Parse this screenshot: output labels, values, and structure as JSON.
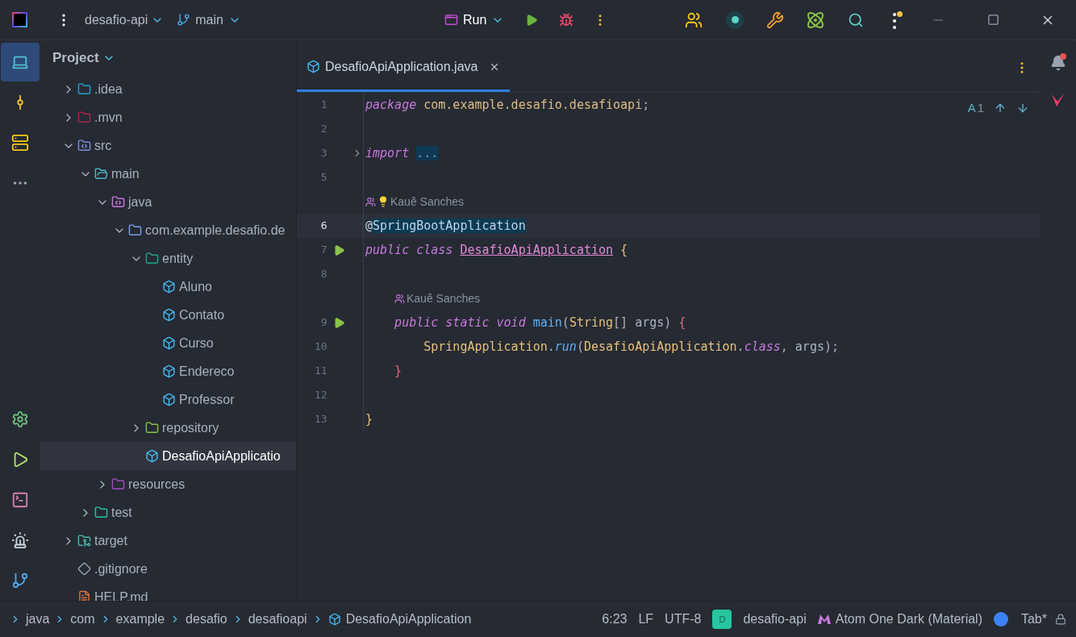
{
  "title_bar": {
    "project": "desafio-api",
    "branch": "main",
    "run_config": "Run"
  },
  "tool_strip": {
    "top": [
      {
        "kind": "project",
        "selected": true
      },
      {
        "kind": "commit",
        "selected": false
      },
      {
        "kind": "structure",
        "selected": false
      },
      {
        "kind": "more",
        "selected": false
      }
    ],
    "bottom": [
      {
        "kind": "settings"
      },
      {
        "kind": "run"
      },
      {
        "kind": "terminal"
      },
      {
        "kind": "problems"
      },
      {
        "kind": "git"
      }
    ]
  },
  "project_panel": {
    "title": "Project",
    "tree": [
      {
        "label": ".idea",
        "kind": "idea",
        "expanded": false,
        "selected": false
      },
      {
        "label": ".mvn",
        "kind": "mvn",
        "expanded": false,
        "selected": false
      },
      {
        "label": "src",
        "kind": "source",
        "expanded": true,
        "selected": false,
        "children": [
          {
            "label": "main",
            "kind": "main",
            "expanded": true,
            "selected": false,
            "children": [
              {
                "label": "java",
                "kind": "java",
                "expanded": true,
                "selected": false,
                "children": [
                  {
                    "label": "com.example.desafio.de",
                    "kind": "package",
                    "expanded": true,
                    "selected": false,
                    "children": [
                      {
                        "label": "entity",
                        "kind": "entity",
                        "expanded": true,
                        "selected": false,
                        "children": [
                          {
                            "label": "Aluno",
                            "kind": "class",
                            "selected": false
                          },
                          {
                            "label": "Contato",
                            "kind": "class",
                            "selected": false
                          },
                          {
                            "label": "Curso",
                            "kind": "class",
                            "selected": false
                          },
                          {
                            "label": "Endereco",
                            "kind": "class",
                            "selected": false
                          },
                          {
                            "label": "Professor",
                            "kind": "class",
                            "selected": false
                          }
                        ]
                      },
                      {
                        "label": "repository",
                        "kind": "repository",
                        "expanded": false,
                        "selected": false
                      },
                      {
                        "label": "DesafioApiApplicatio",
                        "kind": "app",
                        "selected": true
                      }
                    ]
                  }
                ]
              },
              {
                "label": "resources",
                "kind": "resources",
                "expanded": false,
                "selected": false
              }
            ]
          },
          {
            "label": "test",
            "kind": "test",
            "expanded": false,
            "selected": false
          }
        ]
      },
      {
        "label": "target",
        "kind": "target",
        "expanded": false,
        "selected": false
      },
      {
        "label": ".gitignore",
        "kind": "gitignore",
        "selected": false
      },
      {
        "label": "HELP.md",
        "kind": "markdown",
        "selected": false
      }
    ]
  },
  "editor": {
    "tabs": [
      {
        "label": "DesafioApiApplication.java",
        "selected": true
      }
    ],
    "inspection": {
      "label": "A",
      "count": "1"
    },
    "lines": [
      {
        "kind": "code",
        "number": "1",
        "current": false,
        "run": false,
        "fold": false,
        "tokens": [
          {
            "text": "package",
            "kind": "keyword"
          },
          {
            "text": " com.example.desafio.desafioapi",
            "kind": "path"
          },
          {
            "text": ";",
            "kind": "punct"
          }
        ]
      },
      {
        "kind": "code",
        "number": "2",
        "current": false,
        "run": false,
        "fold": false
      },
      {
        "kind": "code",
        "number": "3",
        "current": false,
        "run": false,
        "fold": true,
        "tokens": [
          {
            "text": "import ",
            "kind": "keyword"
          },
          {
            "text": "...",
            "kind": "folded"
          }
        ]
      },
      {
        "kind": "code",
        "number": "5",
        "current": false,
        "run": false,
        "fold": false
      },
      {
        "kind": "author",
        "text": "Kauê Sanches",
        "bulb": true
      },
      {
        "kind": "code",
        "number": "6",
        "current": true,
        "run": false,
        "fold": false,
        "tokens": [
          {
            "text": "@",
            "kind": "annotation"
          },
          {
            "text": "SpringBootApplication",
            "kind": "match"
          }
        ]
      },
      {
        "kind": "code",
        "number": "7",
        "current": false,
        "run": true,
        "fold": false,
        "tokens": [
          {
            "text": "public class ",
            "kind": "keyword"
          },
          {
            "text": "DesafioApiApplication",
            "kind": "classname"
          },
          {
            "text": " {",
            "kind": "brace1"
          }
        ]
      },
      {
        "kind": "code",
        "number": "8",
        "current": false,
        "run": false,
        "fold": false
      },
      {
        "kind": "author",
        "text": "Kauê Sanches",
        "bulb": false
      },
      {
        "kind": "code",
        "number": "9",
        "current": false,
        "run": true,
        "fold": false,
        "tokens": [
          {
            "text": "    public static void ",
            "kind": "keyword"
          },
          {
            "text": "main",
            "kind": "func"
          },
          {
            "text": "(",
            "kind": "punct"
          },
          {
            "text": "String",
            "kind": "type"
          },
          {
            "text": "[] args) ",
            "kind": "punct"
          },
          {
            "text": "{",
            "kind": "brace2"
          }
        ]
      },
      {
        "kind": "code",
        "number": "10",
        "current": false,
        "run": false,
        "fold": false,
        "tokens": [
          {
            "text": "        SpringApplication",
            "kind": "type"
          },
          {
            "text": ".",
            "kind": "punct"
          },
          {
            "text": "run",
            "kind": "call"
          },
          {
            "text": "(",
            "kind": "punct"
          },
          {
            "text": "DesafioApiApplication",
            "kind": "type"
          },
          {
            "text": ".",
            "kind": "punct"
          },
          {
            "text": "class",
            "kind": "keyword"
          },
          {
            "text": ", args);",
            "kind": "punct"
          }
        ]
      },
      {
        "kind": "code",
        "number": "11",
        "current": false,
        "run": false,
        "fold": false,
        "tokens": [
          {
            "text": "    }",
            "kind": "brace2"
          }
        ]
      },
      {
        "kind": "code",
        "number": "12",
        "current": false,
        "run": false,
        "fold": false
      },
      {
        "kind": "code",
        "number": "13",
        "current": false,
        "run": false,
        "fold": false,
        "tokens": [
          {
            "text": "}",
            "kind": "brace1"
          }
        ]
      }
    ]
  },
  "status_bar": {
    "breadcrumbs": [
      {
        "label": "java",
        "kind": "folder"
      },
      {
        "label": "com",
        "kind": "folder"
      },
      {
        "label": "example",
        "kind": "folder"
      },
      {
        "label": "desafio",
        "kind": "folder"
      },
      {
        "label": "desafioapi",
        "kind": "folder"
      },
      {
        "label": "DesafioApiApplication",
        "kind": "class"
      }
    ],
    "position": "6:23",
    "line_separator": "LF",
    "encoding": "UTF-8",
    "project_badge": "D",
    "project": "desafio-api",
    "theme": "Atom One Dark (Material)",
    "indent": "Tab*"
  }
}
